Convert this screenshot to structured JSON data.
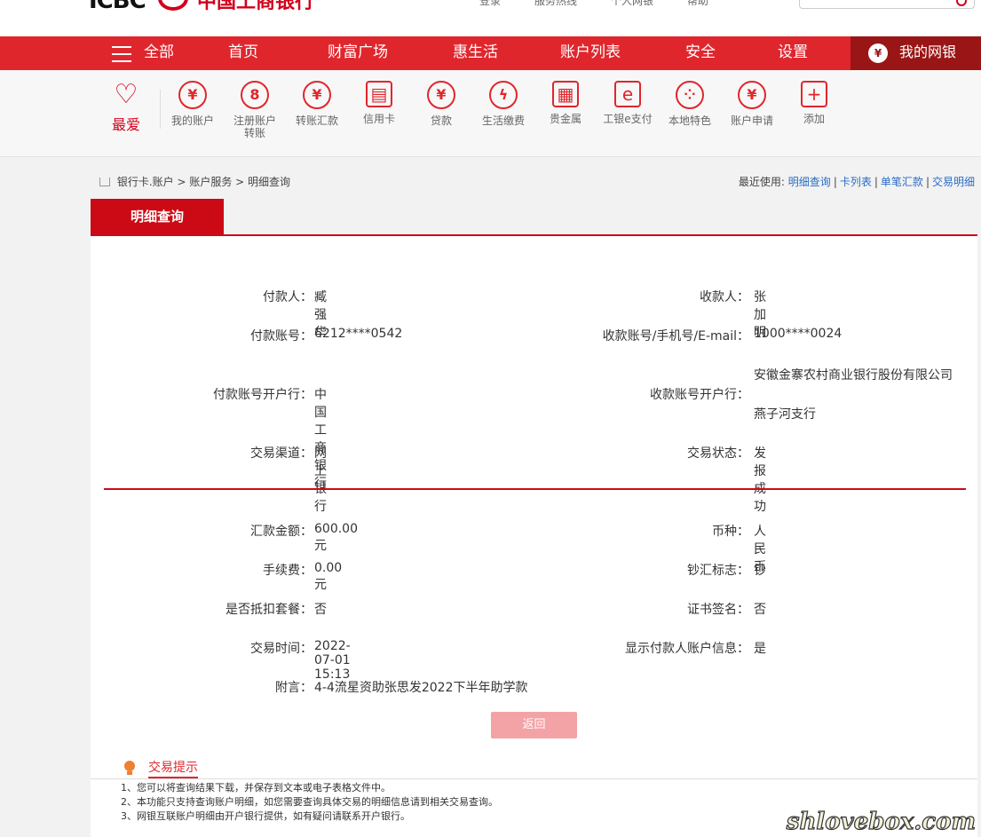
{
  "header": {
    "logo_text": "ICBC",
    "logo_cn": "中国工商银行",
    "top_links": [
      "登录",
      "服务热线",
      "个人网银",
      "帮助"
    ]
  },
  "nav": {
    "items": [
      "全部",
      "首页",
      "财富广场",
      "惠生活",
      "账户列表",
      "安全",
      "设置"
    ],
    "my_bank": "我的网银",
    "my_bank_icon": "money-bag-icon"
  },
  "iconbar": {
    "favorite": "最爱",
    "items": [
      {
        "label": "我的账户",
        "glyph": "¥",
        "icon": "account-yen-icon"
      },
      {
        "label": "注册账户\n转账",
        "glyph": "8",
        "icon": "register-transfer-icon"
      },
      {
        "label": "转账汇款",
        "glyph": "¥",
        "icon": "transfer-icon"
      },
      {
        "label": "信用卡",
        "glyph": "▤",
        "icon": "credit-card-icon"
      },
      {
        "label": "贷款",
        "glyph": "¥",
        "icon": "loan-bag-icon"
      },
      {
        "label": "生活缴费",
        "glyph": "ϟ",
        "icon": "utility-icon"
      },
      {
        "label": "贵金属",
        "glyph": "▦",
        "icon": "gold-bars-icon"
      },
      {
        "label": "工银e支付",
        "glyph": "e",
        "icon": "e-pay-icon"
      },
      {
        "label": "本地特色",
        "glyph": "⁘",
        "icon": "local-feature-icon"
      },
      {
        "label": "账户申请",
        "glyph": "¥",
        "icon": "account-apply-icon"
      },
      {
        "label": "添加",
        "glyph": "+",
        "icon": "add-icon"
      }
    ]
  },
  "breadcrumb": {
    "items": [
      "银行卡.账户",
      "账户服务",
      "明细查询"
    ],
    "sep": " > "
  },
  "recent": {
    "label": "最近使用:",
    "links": [
      "明细查询",
      "卡列表",
      "单笔汇款",
      "交易明细"
    ]
  },
  "tab": "明细查询",
  "details": {
    "payer_label": "付款人：",
    "payer": "臧强华",
    "payee_label": "收款人：",
    "payee": "张加明",
    "payer_acct_label": "付款账号：",
    "payer_acct": "6212****0542",
    "payee_acct_label": "收款账号/手机号/E-mail：",
    "payee_acct": "1000****0024",
    "payer_bank_label": "付款账号开户行：",
    "payer_bank": "中国工商银行",
    "payee_bank_label": "收款账号开户行：",
    "payee_bank_line1": "安徽金寨农村商业银行股份有限公司",
    "payee_bank_line2": "燕子河支行",
    "channel_label": "交易渠道：",
    "channel": "网上银行",
    "status_label": "交易状态：",
    "status": "发报成功",
    "amount_label": "汇款金额：",
    "amount": "600.00元",
    "currency_label": "币种：",
    "currency": "人民币",
    "fee_label": "手续费：",
    "fee": "0.00元",
    "cash_flag_label": "钞汇标志：",
    "cash_flag": "钞",
    "package_label": "是否抵扣套餐：",
    "package": "否",
    "cert_label": "证书签名：",
    "cert": "否",
    "time_label": "交易时间：",
    "time": "2022-07-01 15:13",
    "show_payer_label": "显示付款人账户信息：",
    "show_payer": "是",
    "memo_label": "附言：",
    "memo": "4-4流星资助张思发2022下半年助学款"
  },
  "return_button": "返回",
  "tips": {
    "title": "交易提示",
    "lines": [
      "1、您可以将查询结果下载，并保存到文本或电子表格文件中。",
      "2、本功能只支持查询账户明细，如您需要查询具体交易的明细信息请到相关交易查询。",
      "3、网银互联账户明细由开户银行提供，如有疑问请联系开户银行。"
    ]
  },
  "watermark": "shlovebox.com",
  "colors": {
    "brand_red": "#e0262d",
    "dark_red": "#cc0a15",
    "link_blue": "#2a6cc6"
  }
}
